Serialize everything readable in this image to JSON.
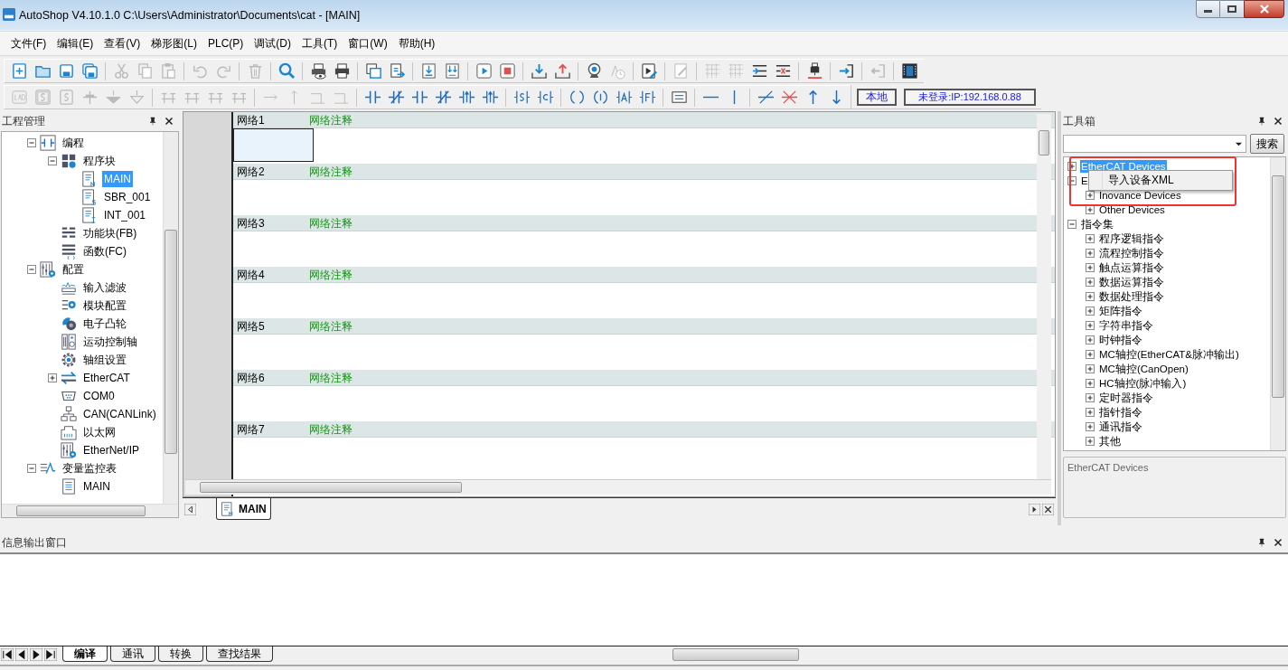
{
  "window": {
    "title": "AutoShop V4.10.1.0  C:\\Users\\Administrator\\Documents\\cat - [MAIN]"
  },
  "menu": [
    "文件(F)",
    "编辑(E)",
    "查看(V)",
    "梯形图(L)",
    "PLC(P)",
    "调试(D)",
    "工具(T)",
    "窗口(W)",
    "帮助(H)"
  ],
  "toolbar_1": [
    {
      "kind": "new",
      "disabled": false
    },
    {
      "kind": "open",
      "disabled": false
    },
    {
      "kind": "save",
      "disabled": false
    },
    {
      "kind": "saveall",
      "disabled": false
    },
    {
      "kind": "sep"
    },
    {
      "kind": "cut",
      "disabled": true
    },
    {
      "kind": "copy",
      "disabled": true
    },
    {
      "kind": "paste",
      "disabled": true
    },
    {
      "kind": "sep"
    },
    {
      "kind": "undo",
      "disabled": true
    },
    {
      "kind": "redo",
      "disabled": true
    },
    {
      "kind": "sep"
    },
    {
      "kind": "delete",
      "disabled": true
    },
    {
      "kind": "sep"
    },
    {
      "kind": "search",
      "disabled": false
    },
    {
      "kind": "sep"
    },
    {
      "kind": "preview",
      "disabled": false
    },
    {
      "kind": "print",
      "disabled": false
    },
    {
      "kind": "sep"
    },
    {
      "kind": "windows",
      "disabled": false
    },
    {
      "kind": "export",
      "disabled": false
    },
    {
      "kind": "sep"
    },
    {
      "kind": "docdown",
      "disabled": false
    },
    {
      "kind": "docdown2",
      "disabled": false
    },
    {
      "kind": "sep"
    },
    {
      "kind": "run",
      "disabled": false
    },
    {
      "kind": "stop",
      "disabled": false
    },
    {
      "kind": "sep"
    },
    {
      "kind": "download",
      "disabled": false
    },
    {
      "kind": "upload",
      "disabled": false
    },
    {
      "kind": "sep"
    },
    {
      "kind": "camera",
      "disabled": false
    },
    {
      "kind": "clock",
      "disabled": true
    },
    {
      "kind": "sep"
    },
    {
      "kind": "monitor",
      "disabled": false
    },
    {
      "kind": "sep"
    },
    {
      "kind": "pencil",
      "disabled": true
    },
    {
      "kind": "sep"
    },
    {
      "kind": "grid",
      "disabled": true
    },
    {
      "kind": "grid",
      "disabled": true
    },
    {
      "kind": "insertrow",
      "disabled": false
    },
    {
      "kind": "deleterow",
      "disabled": false
    },
    {
      "kind": "sep"
    },
    {
      "kind": "usb",
      "disabled": false
    },
    {
      "kind": "sep"
    },
    {
      "kind": "login",
      "disabled": false
    },
    {
      "kind": "sep"
    },
    {
      "kind": "logout",
      "disabled": true
    },
    {
      "kind": "sep"
    },
    {
      "kind": "film",
      "disabled": false
    }
  ],
  "toolbar_2": [
    {
      "kind": "lad",
      "disabled": true
    },
    {
      "kind": "sbox",
      "disabled": true
    },
    {
      "kind": "sbox2",
      "disabled": true
    },
    {
      "kind": "vbranch",
      "disabled": true
    },
    {
      "kind": "downfill",
      "disabled": true
    },
    {
      "kind": "downoutline",
      "disabled": true
    },
    {
      "kind": "sep"
    },
    {
      "kind": "branch",
      "disabled": true
    },
    {
      "kind": "branch",
      "disabled": true
    },
    {
      "kind": "branch",
      "disabled": true
    },
    {
      "kind": "branch",
      "disabled": true
    },
    {
      "kind": "sep"
    },
    {
      "kind": "hline",
      "disabled": true
    },
    {
      "kind": "vline",
      "disabled": true
    },
    {
      "kind": "corner",
      "disabled": true
    },
    {
      "kind": "corner",
      "disabled": true
    },
    {
      "kind": "sep"
    },
    {
      "kind": "contact",
      "disabled": false
    },
    {
      "kind": "ncontact",
      "disabled": false
    },
    {
      "kind": "contact",
      "disabled": false
    },
    {
      "kind": "ncontact",
      "disabled": false
    },
    {
      "kind": "pcontact",
      "disabled": false
    },
    {
      "kind": "pcontact",
      "disabled": false
    },
    {
      "kind": "sep"
    },
    {
      "kind": "setcoil",
      "disabled": false
    },
    {
      "kind": "ccoil",
      "disabled": false
    },
    {
      "kind": "sep"
    },
    {
      "kind": "coil",
      "disabled": false
    },
    {
      "kind": "icoil",
      "disabled": false
    },
    {
      "kind": "acoil",
      "disabled": false
    },
    {
      "kind": "fcoil",
      "disabled": false
    },
    {
      "kind": "sep"
    },
    {
      "kind": "comment",
      "disabled": false
    },
    {
      "kind": "sep"
    },
    {
      "kind": "hwire",
      "disabled": false
    },
    {
      "kind": "vwire",
      "disabled": false
    },
    {
      "kind": "sep"
    },
    {
      "kind": "slash",
      "disabled": false
    },
    {
      "kind": "xdel",
      "disabled": false
    },
    {
      "kind": "up",
      "disabled": false
    },
    {
      "kind": "down",
      "disabled": false
    }
  ],
  "connection": {
    "local_button": "本地",
    "status": "未登录:IP:192.168.0.88"
  },
  "project_panel": {
    "title": "工程管理",
    "tree": [
      {
        "label": "编程",
        "expanded": true,
        "selected": false,
        "children": [
          {
            "label": "程序块",
            "expanded": true,
            "selected": false,
            "children": [
              {
                "label": "MAIN",
                "selected": true
              },
              {
                "label": "SBR_001",
                "selected": false
              },
              {
                "label": "INT_001",
                "selected": false
              }
            ]
          },
          {
            "label": "功能块(FB)",
            "selected": false
          },
          {
            "label": "函数(FC)",
            "selected": false
          }
        ]
      },
      {
        "label": "配置",
        "expanded": true,
        "selected": false,
        "children": [
          {
            "label": "输入滤波",
            "selected": false
          },
          {
            "label": "模块配置",
            "selected": false
          },
          {
            "label": "电子凸轮",
            "selected": false
          },
          {
            "label": "运动控制轴",
            "selected": false
          },
          {
            "label": "轴组设置",
            "selected": false
          },
          {
            "label": "EtherCAT",
            "expanded": false,
            "selected": false
          },
          {
            "label": "COM0",
            "selected": false
          },
          {
            "label": "CAN(CANLink)",
            "selected": false
          },
          {
            "label": "以太网",
            "selected": false
          },
          {
            "label": "EtherNet/IP",
            "selected": false
          }
        ]
      },
      {
        "label": "变量监控表",
        "expanded": true,
        "selected": false,
        "children": [
          {
            "label": "MAIN",
            "selected": false
          }
        ]
      }
    ]
  },
  "editor": {
    "networks": [
      {
        "label": "网络1",
        "comment": "网络注释"
      },
      {
        "label": "网络2",
        "comment": "网络注释"
      },
      {
        "label": "网络3",
        "comment": "网络注释"
      },
      {
        "label": "网络4",
        "comment": "网络注释"
      },
      {
        "label": "网络5",
        "comment": "网络注释"
      },
      {
        "label": "网络6",
        "comment": "网络注释"
      },
      {
        "label": "网络7",
        "comment": "网络注释"
      }
    ],
    "tabs": [
      {
        "label": "MAIN",
        "selected": true
      }
    ]
  },
  "toolbox": {
    "title": "工具箱",
    "search_button": "搜索",
    "tree": [
      {
        "label": "EtherCAT Devices",
        "expanded": false,
        "selected": true
      },
      {
        "label": "E",
        "expanded": true,
        "selected": false,
        "children": [
          {
            "label": "Inovance Devices",
            "expanded": false,
            "selected": false
          },
          {
            "label": "Other Devices",
            "expanded": false,
            "selected": false
          }
        ]
      },
      {
        "label": "指令集",
        "expanded": true,
        "selected": false,
        "children": [
          {
            "label": "程序逻辑指令",
            "expanded": false,
            "selected": false
          },
          {
            "label": "流程控制指令",
            "expanded": false,
            "selected": false
          },
          {
            "label": "触点运算指令",
            "expanded": false,
            "selected": false
          },
          {
            "label": "数据运算指令",
            "expanded": false,
            "selected": false
          },
          {
            "label": "数据处理指令",
            "expanded": false,
            "selected": false
          },
          {
            "label": "矩阵指令",
            "expanded": false,
            "selected": false
          },
          {
            "label": "字符串指令",
            "expanded": false,
            "selected": false
          },
          {
            "label": "时钟指令",
            "expanded": false,
            "selected": false
          },
          {
            "label": "MC轴控(EtherCAT&脉冲输出)",
            "expanded": false,
            "selected": false
          },
          {
            "label": "MC轴控(CanOpen)",
            "expanded": false,
            "selected": false
          },
          {
            "label": "HC轴控(脉冲输入)",
            "expanded": false,
            "selected": false
          },
          {
            "label": "定时器指令",
            "expanded": false,
            "selected": false
          },
          {
            "label": "指针指令",
            "expanded": false,
            "selected": false
          },
          {
            "label": "通讯指令",
            "expanded": false,
            "selected": false
          },
          {
            "label": "其他",
            "expanded": false,
            "selected": false
          }
        ]
      }
    ],
    "description": "EtherCAT Devices",
    "context_menu": [
      "导入设备XML"
    ]
  },
  "output_window": {
    "title": "信息输出窗口",
    "tabs": [
      {
        "label": "编译",
        "selected": true
      },
      {
        "label": "通讯",
        "selected": false
      },
      {
        "label": "转换",
        "selected": false
      },
      {
        "label": "查找结果",
        "selected": false
      }
    ]
  }
}
